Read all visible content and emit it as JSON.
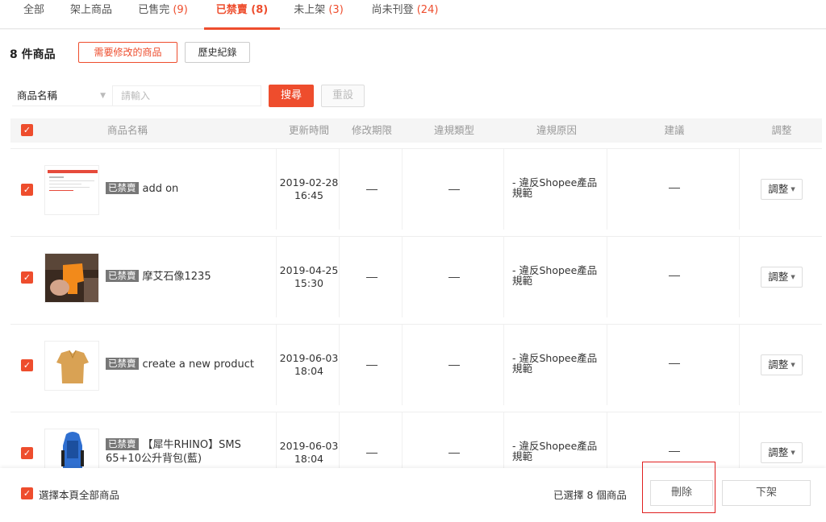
{
  "tabs": [
    {
      "label": "全部",
      "count": ""
    },
    {
      "label": "架上商品",
      "count": ""
    },
    {
      "label": "已售完",
      "count": "(9)"
    },
    {
      "label": "已禁賣",
      "count": "(8)"
    },
    {
      "label": "未上架",
      "count": "(3)"
    },
    {
      "label": "尚未刊登",
      "count": "(24)"
    }
  ],
  "summary": {
    "count_text": "8 件商品",
    "filter_button": "需要修改的商品",
    "history_button": "歷史紀錄"
  },
  "search": {
    "field": "商品名稱",
    "placeholder": "請輸入",
    "search_button": "搜尋",
    "reset_button": "重設"
  },
  "columns": {
    "name": "商品名稱",
    "updated": "更新時間",
    "deadline": "修改期限",
    "type": "違規類型",
    "reason": "違規原因",
    "suggestion": "建議",
    "adjust": "調整"
  },
  "rows": [
    {
      "badge": "已禁賣",
      "name": "add on",
      "date": "2019-02-28",
      "time": "16:45",
      "reason": "- 違反Shopee產品規範",
      "adjust": "調整",
      "thumb": "screenshot"
    },
    {
      "badge": "已禁賣",
      "name": "摩艾石像1235",
      "date": "2019-04-25",
      "time": "15:30",
      "reason": "- 違反Shopee產品規範",
      "adjust": "調整",
      "thumb": "orange-figure"
    },
    {
      "badge": "已禁賣",
      "name": "create a new product",
      "date": "2019-06-03",
      "time": "18:04",
      "reason": "- 違反Shopee產品規範",
      "adjust": "調整",
      "thumb": "shirt"
    },
    {
      "badge": "已禁賣",
      "name": "【犀牛RHINO】SMS 65+10公升背包(藍)",
      "date": "2019-06-03",
      "time": "18:04",
      "reason": "- 違反Shopee產品規範",
      "adjust": "調整",
      "thumb": "backpack"
    }
  ],
  "footer": {
    "select_all": "選擇本頁全部商品",
    "selected": "已選擇 8 個商品",
    "delete_button": "刪除",
    "unlist_button": "下架"
  },
  "colors": {
    "accent": "#ee4d2d",
    "badge": "#777777",
    "highlight": "#e02020"
  }
}
